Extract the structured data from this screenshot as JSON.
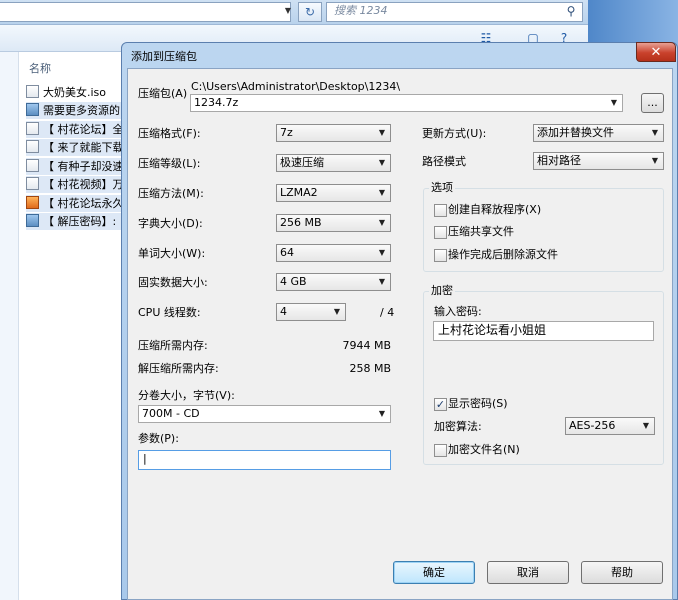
{
  "explorer": {
    "search_placeholder": "搜索 1234",
    "column_name": "名称",
    "files": [
      {
        "name": "大奶美女.iso",
        "icon": "file"
      },
      {
        "name": "需要更多资源的",
        "icon": "image"
      },
      {
        "name": "【 村花论坛】全",
        "icon": "file"
      },
      {
        "name": "【 来了就能下载",
        "icon": "file"
      },
      {
        "name": "【 有种子却没速",
        "icon": "file"
      },
      {
        "name": "【 村花视频】万",
        "icon": "file"
      },
      {
        "name": "【 村花论坛永久",
        "icon": "app"
      },
      {
        "name": "【 解压密码】:",
        "icon": "image"
      }
    ]
  },
  "dialog": {
    "title": "添加到压缩包",
    "close_glyph": "✕",
    "archive_label": "压缩包(A)",
    "archive_path": "C:\\Users\\Administrator\\Desktop\\1234\\",
    "archive_name": "1234.7z",
    "browse_label": "...",
    "format": {
      "label": "压缩格式(F):",
      "value": "7z"
    },
    "level": {
      "label": "压缩等级(L):",
      "value": "极速压缩"
    },
    "method": {
      "label": "压缩方法(M):",
      "value": "LZMA2"
    },
    "dict": {
      "label": "字典大小(D):",
      "value": "256 MB"
    },
    "word": {
      "label": "单词大小(W):",
      "value": "64"
    },
    "solid": {
      "label": "固实数据大小:",
      "value": "4 GB"
    },
    "threads": {
      "label": "CPU 线程数:",
      "value": "4",
      "max": "/ 4"
    },
    "mem_compress": {
      "label": "压缩所需内存:",
      "value": "7944 MB"
    },
    "mem_decompress": {
      "label": "解压缩所需内存:",
      "value": "258 MB"
    },
    "split": {
      "label": "分卷大小，字节(V):",
      "value": "700M - CD"
    },
    "params": {
      "label": "参数(P):",
      "value": "|"
    },
    "update": {
      "label": "更新方式(U):",
      "value": "添加并替换文件"
    },
    "pathmode": {
      "label": "路径模式",
      "value": "相对路径"
    },
    "options": {
      "title": "选项",
      "sfx": {
        "label": "创建自释放程序(X)",
        "checked": false
      },
      "shared": {
        "label": "压缩共享文件",
        "checked": false
      },
      "delete": {
        "label": "操作完成后删除源文件",
        "checked": false
      }
    },
    "encryption": {
      "title": "加密",
      "password_label": "输入密码:",
      "password_value": "上村花论坛看小姐姐",
      "show_password": {
        "label": "显示密码(S)",
        "checked": true
      },
      "method_label": "加密算法:",
      "method_value": "AES-256",
      "encrypt_names": {
        "label": "加密文件名(N)",
        "checked": false
      }
    },
    "buttons": {
      "ok": "确定",
      "cancel": "取消",
      "help": "帮助"
    }
  }
}
